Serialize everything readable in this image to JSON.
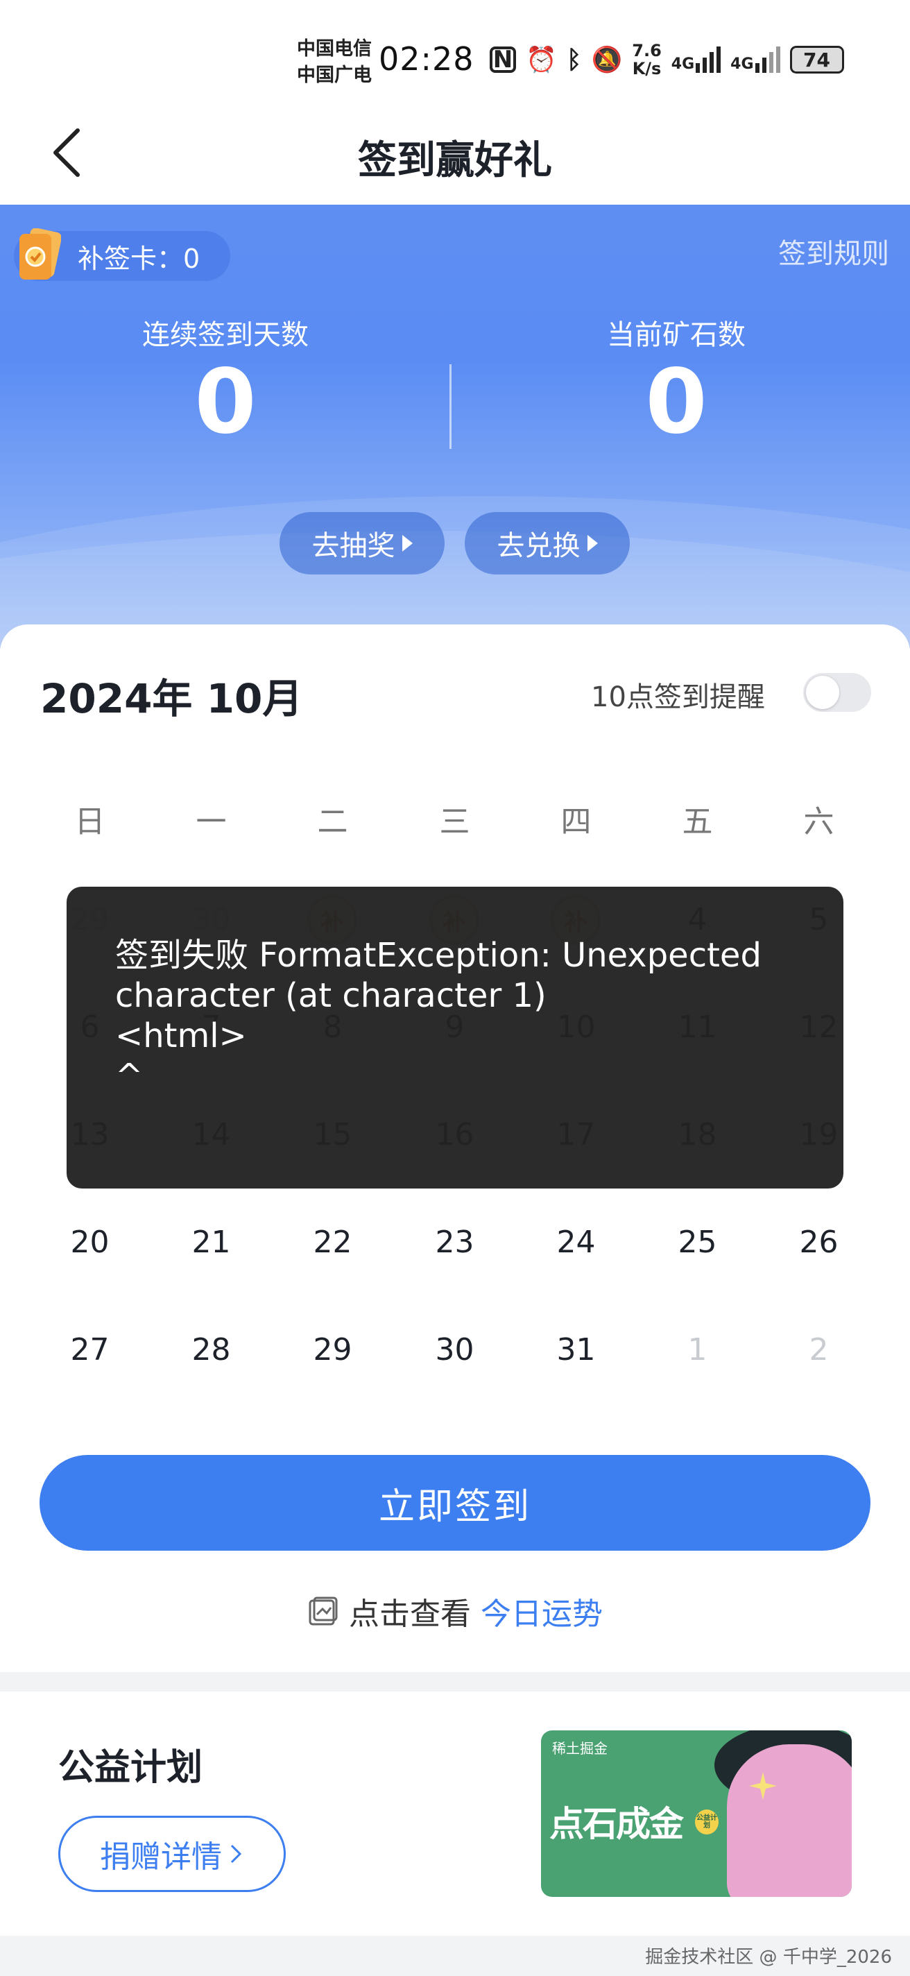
{
  "status_bar": {
    "carrier1": "中国电信",
    "carrier2": "中国广电",
    "time": "02:28",
    "speed_top": "7.6",
    "speed_bottom": "K/s",
    "net1": "4G",
    "net2": "4G",
    "battery": "74",
    "icons": [
      "nfc-icon",
      "alarm-icon",
      "bluetooth-icon",
      "mute-icon",
      "signal-icon",
      "signal-icon",
      "battery-icon"
    ]
  },
  "nav": {
    "title": "签到赢好礼",
    "back_icon": "chevron-left-icon"
  },
  "hero": {
    "makeup_card": "补签卡：0",
    "rules": "签到规则",
    "streak_label": "连续签到天数",
    "streak_value": "0",
    "ore_label": "当前矿石数",
    "ore_value": "0",
    "lottery_button": "去抽奖",
    "exchange_button": "去兑换"
  },
  "calendar": {
    "month_title": "2024年 10月",
    "reminder_label": "10点签到提醒",
    "reminder_on": false,
    "weekdays": [
      "日",
      "一",
      "二",
      "三",
      "四",
      "五",
      "六"
    ],
    "rows": [
      [
        "29",
        "30",
        "补",
        "补",
        "补",
        "4",
        "5"
      ],
      [
        "6",
        "7",
        "8",
        "9",
        "10",
        "11",
        "12"
      ],
      [
        "13",
        "14",
        "15",
        "16",
        "17",
        "18",
        "19"
      ],
      [
        "20",
        "21",
        "22",
        "23",
        "24",
        "25",
        "26"
      ],
      [
        "27",
        "28",
        "29",
        "30",
        "31",
        "1",
        "2"
      ]
    ],
    "makeup_badge": "补"
  },
  "toast": {
    "message": "签到失败 FormatException: Unexpected\ncharacter (at character 1)\n<html>\n^"
  },
  "checkin_button": "立即签到",
  "fortune": {
    "prefix": "点击查看",
    "link": "今日运势"
  },
  "charity": {
    "title": "公益计划",
    "donate_button": "捐赠详情",
    "banner_top": "稀土掘金",
    "banner_title": "点石成金",
    "banner_badge": "公益计划"
  },
  "watermark": "掘金技术社区 @ 千中学_2026",
  "colors": {
    "primary": "#3d7ff0",
    "hero": "#5a8cf3",
    "toast": "#222222"
  }
}
